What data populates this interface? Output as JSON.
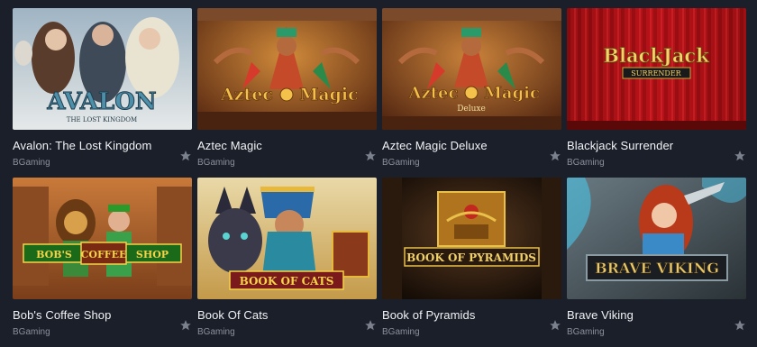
{
  "games": [
    {
      "title": "Avalon: The Lost Kingdom",
      "provider": "BGaming",
      "logo_main": "AVALON",
      "logo_sub": "THE LOST KINGDOM",
      "favorite_icon": "star-icon"
    },
    {
      "title": "Aztec Magic",
      "provider": "BGaming",
      "logo_left": "Aztec",
      "logo_right": "Magic",
      "favorite_icon": "star-icon"
    },
    {
      "title": "Aztec Magic Deluxe",
      "provider": "BGaming",
      "logo_left": "Aztec",
      "logo_right": "Magic",
      "logo_sub": "Deluxe",
      "favorite_icon": "star-icon"
    },
    {
      "title": "Blackjack Surrender",
      "provider": "BGaming",
      "logo_main": "BlackJack",
      "logo_sub": "SURRENDER",
      "favorite_icon": "star-icon"
    },
    {
      "title": "Bob's Coffee Shop",
      "provider": "BGaming",
      "logo_left": "BOB'S",
      "logo_mid": "COFFEE",
      "logo_right": "SHOP",
      "favorite_icon": "star-icon"
    },
    {
      "title": "Book Of Cats",
      "provider": "BGaming",
      "logo_main": "BOOK OF CATS",
      "favorite_icon": "star-icon"
    },
    {
      "title": "Book of Pyramids",
      "provider": "BGaming",
      "logo_main": "BOOK OF PYRAMIDS",
      "favorite_icon": "star-icon"
    },
    {
      "title": "Brave Viking",
      "provider": "BGaming",
      "logo_main": "BRAVE VIKING",
      "favorite_icon": "star-icon"
    }
  ],
  "colors": {
    "background": "#1b1f2a",
    "title": "#f2f3f5",
    "provider": "#8a909c",
    "star": "#7b818d"
  }
}
